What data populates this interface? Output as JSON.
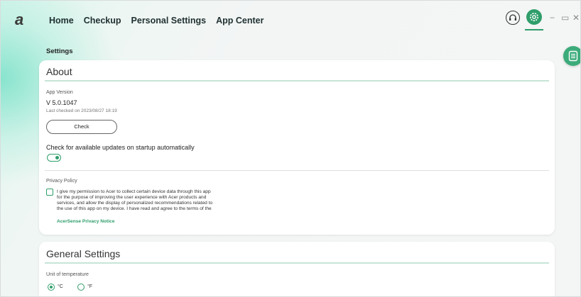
{
  "app": {
    "logo": "a",
    "nav": [
      "Home",
      "Checkup",
      "Personal Settings",
      "App Center"
    ],
    "window_controls": [
      "−",
      "▭",
      "✕"
    ],
    "accent_color": "#2f9e6b"
  },
  "page": {
    "label": "Settings"
  },
  "about": {
    "title": "About",
    "app_version_label": "App Version",
    "version": "V 5.0.1047",
    "last_checked": "Last checked on 2023/08/27 18:19",
    "check_button": "Check",
    "auto_update_label": "Check for available updates on startup automatically",
    "auto_update_enabled": true,
    "privacy_label": "Privacy Policy",
    "privacy_checked": false,
    "privacy_lines": [
      "I give my permission to Acer to collect certain device data through this app",
      "for the purpose of improving the user experience with Acer products and",
      "services, and allow the display of personalized recommendations related to",
      "the use of this app on my device. I have read and agree to the terms of the"
    ],
    "privacy_link": "AcerSense Privacy Notice"
  },
  "general": {
    "title": "General Settings",
    "unit_label": "Unit of temperature",
    "units": [
      "°C",
      "°F"
    ],
    "selected_unit": "°C"
  }
}
